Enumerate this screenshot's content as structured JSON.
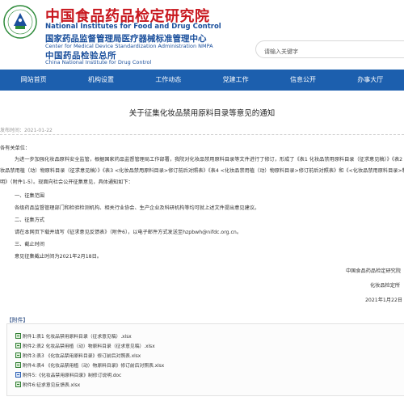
{
  "header": {
    "title_cn": "中国食品药品检定研究院",
    "title_en": "National Institutes for Food and Drug Control",
    "sub_cn": "国家药品监督管理局医疗器械标准管理中心",
    "sub_en": "Center for Medical Device Standardization Administration NMPA",
    "sub2_cn": "中国药品检验总所",
    "sub2_en": "China National Institute for Drug Control",
    "logo_text": "NIFDC 中国药检",
    "search_placeholder": "请输入关键字"
  },
  "nav": [
    "网站首页",
    "机构设置",
    "工作动态",
    "党建工作",
    "信息公开",
    "办事大厅"
  ],
  "article": {
    "title": "关于征集化妆品禁用原料目录等意见的通知",
    "meta": "发布时间：2021-01-22",
    "greeting": "各有关单位：",
    "para1_line1": "为进一步加强化妆品原料安全监管，根据国家药品监督管理局工作部署，我院对化妆品禁用原料目录等文件进行了修订，形成了《表1 化妆品禁用原料目录（征求意见稿）》《表2 化",
    "para1_line2": "妆品禁用植（动）物原料目录（征求意见稿）》《表3 <化妆品禁用原料目录>修订前后对照表》《表4 <化妆品禁用植（动）物原料目录>修订前后对照表》和《<化妆品禁用原料目录>制修订说",
    "para1_line3": "明》（附件1-5）。现面向社会公开征集意见，具体通知如下：",
    "s1_head": "一、征集范围",
    "s1_body": "各级药品监督管理部门和检验检测机构、相关行业协会、生产企业及科研机构等均可就上述文件提出意见建议。",
    "s2_head": "二、征集方式",
    "s2_body": "请在本网页下载并填写《征求意见反馈表》（附件6），以电子邮件方式发送至hzpbwh@nifdc.org.cn。",
    "s3_head": "三、截止时间",
    "s3_body": "意见征集截止时间为2021年2月18日。",
    "sign1": "中国食品药品检定研究院",
    "sign2": "化妆品检定所",
    "date": "2021年1月22日"
  },
  "attachments": {
    "title": "【附件】",
    "items": [
      "附件1:表1 化妆品禁用原料目录（征求意见稿）.xlsx",
      "附件2:表2 化妆品禁用植（动）物原料目录（征求意见稿）.xlsx",
      "附件3:表3 《化妆品禁用原料目录》修订前后对照表.xlsx",
      "附件4:表4 《化妆品禁用植（动）物原料目录》修订前后对照表.xlsx",
      "附件5:《化妆品禁用原料目录》制修订说明.doc",
      "附件6:征求意见反馈表.xlsx"
    ]
  },
  "colors": {
    "nav_bg": "#1c5fae",
    "title_red": "#c8161d",
    "brand_blue": "#1a4f9c"
  }
}
